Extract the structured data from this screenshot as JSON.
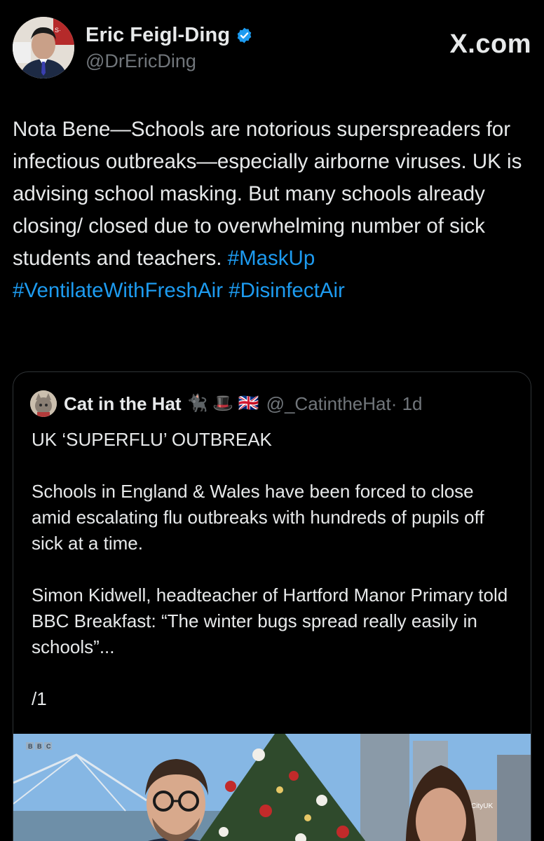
{
  "author": {
    "display_name": "Eric Feigl-Ding",
    "handle": "@DrEricDing",
    "verified": true
  },
  "brand": "X.com",
  "tweet": {
    "text": "Nota Bene—Schools are notorious superspreaders for infectious outbreaks—especially airborne viruses. UK is advising school masking. But many schools already closing/ closed due to overwhelming number of sick students and teachers. ",
    "hashtags": [
      "#MaskUp",
      "#VentilateWithFreshAir",
      "#DisinfectAir"
    ]
  },
  "quote": {
    "display_name": "Cat in the Hat",
    "name_emoji": "🐈‍⬛ 🎩 🇬🇧",
    "handle": "@_CatintheHat",
    "time": " · 1d",
    "paragraphs": [
      "UK ‘SUPERFLU’ OUTBREAK",
      "Schools in England & Wales have been forced to close amid escalating flu outbreaks with hundreds of pupils off sick at a time.",
      "Simon Kidwell, headteacher of Hartford Manor Primary told BBC Breakfast: “The winter bugs spread really easily in schools”...",
      "/1"
    ]
  },
  "media": {
    "channel_logo": "BBC",
    "screen_caption": "CityUK"
  },
  "colors": {
    "background": "#000000",
    "text": "#e7e9ea",
    "secondary": "#71767b",
    "accent": "#1d9bf0",
    "border": "#2f3336"
  }
}
